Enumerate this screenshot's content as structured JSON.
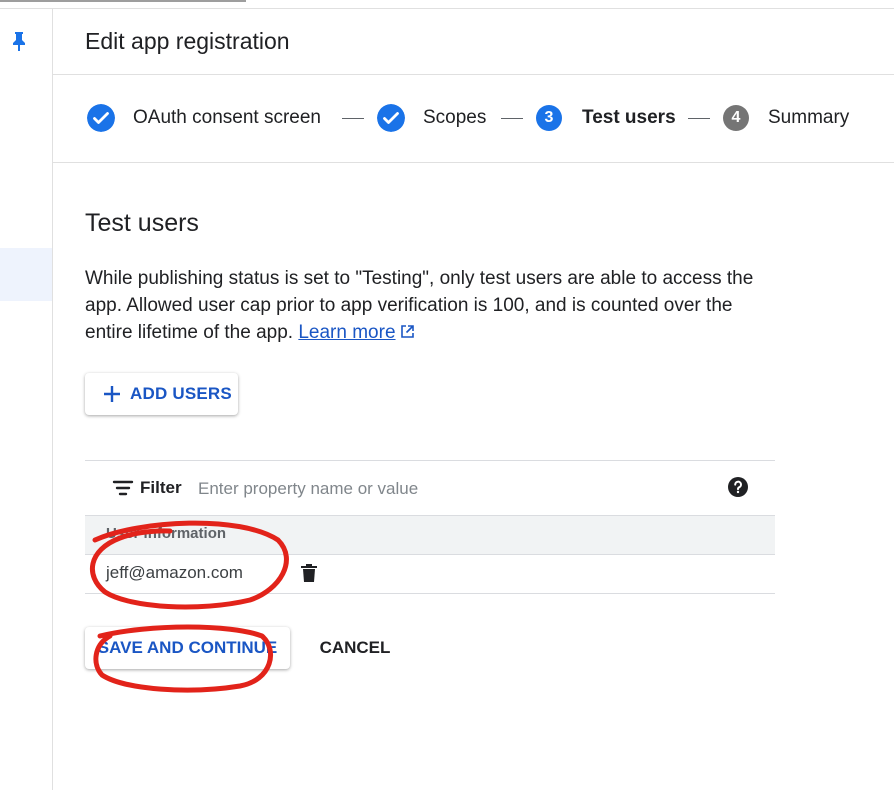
{
  "header": {
    "title": "Edit app registration"
  },
  "stepper": {
    "steps": [
      {
        "label": "OAuth consent screen",
        "state": "done"
      },
      {
        "label": "Scopes",
        "state": "done"
      },
      {
        "label": "Test users",
        "number": "3",
        "state": "active"
      },
      {
        "label": "Summary",
        "number": "4",
        "state": "pending"
      }
    ]
  },
  "section": {
    "title": "Test users",
    "description": "While publishing status is set to \"Testing\", only test users are able to access the app. Allowed user cap prior to app verification is 100, and is counted over the entire lifetime of the app.",
    "learn_more": "Learn more"
  },
  "add_users_button": "ADD USERS",
  "filter": {
    "label": "Filter",
    "placeholder": "Enter property name or value"
  },
  "table": {
    "column_header": "User information",
    "rows": [
      {
        "email": "jeff@amazon.com"
      }
    ]
  },
  "actions": {
    "save": "SAVE AND CONTINUE",
    "cancel": "CANCEL"
  },
  "colors": {
    "primary": "#1a73e8",
    "link": "#1a56c4",
    "pending": "#757575",
    "annotation": "#e2231a"
  },
  "icons": [
    "pin-icon",
    "check-circle-icon",
    "plus-icon",
    "filter-icon",
    "help-icon",
    "trash-icon",
    "external-link-icon"
  ]
}
